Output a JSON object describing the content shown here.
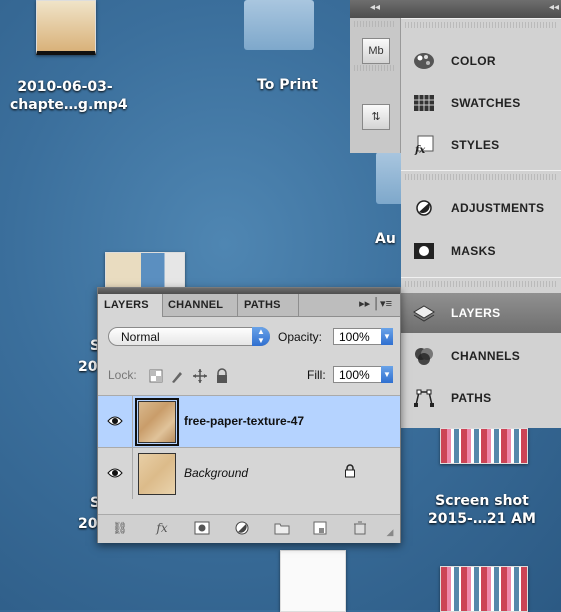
{
  "desktop": {
    "items": [
      {
        "name_line1": "2010-06-03-",
        "name_line2": "chapte…g.mp4"
      },
      {
        "name_line1": "To Print"
      },
      {
        "name_line1": "Au"
      },
      {
        "name_line1": "S"
      },
      {
        "name_line1": "20"
      },
      {
        "name_line1": "S"
      },
      {
        "name_line1": "20"
      },
      {
        "name_line1": "Screen shot",
        "name_line2": "2015-…21 AM"
      }
    ]
  },
  "dock_panel": {
    "collapse_glyph": "◂◂",
    "items": [
      {
        "label": "COLOR",
        "icon": "color-icon"
      },
      {
        "label": "SWATCHES",
        "icon": "swatches-icon"
      },
      {
        "label": "STYLES",
        "icon": "styles-icon"
      },
      {
        "label": "ADJUSTMENTS",
        "icon": "adjustments-icon"
      },
      {
        "label": "MASKS",
        "icon": "masks-icon"
      },
      {
        "label": "LAYERS",
        "icon": "layers-icon"
      },
      {
        "label": "CHANNELS",
        "icon": "channels-icon"
      },
      {
        "label": "PATHS",
        "icon": "paths-icon"
      }
    ],
    "side_icons": [
      {
        "label": "Mb"
      },
      {
        "label": "⇅"
      }
    ]
  },
  "layers_panel": {
    "tabs": [
      "LAYERS",
      "CHANNEL",
      "PATHS"
    ],
    "tab_overflow": "▸▸ │▾≡",
    "blend_mode": "Normal",
    "opacity_label": "Opacity:",
    "opacity_value": "100%",
    "lock_label": "Lock:",
    "fill_label": "Fill:",
    "fill_value": "100%",
    "layers": [
      {
        "name": "free-paper-texture-47",
        "selected": true,
        "locked": false
      },
      {
        "name": "Background",
        "selected": false,
        "locked": true
      }
    ],
    "bottom_icons": [
      "link-icon",
      "fx-icon",
      "mask-icon",
      "adjustment-icon",
      "folder-icon",
      "new-layer-icon",
      "trash-icon"
    ]
  }
}
